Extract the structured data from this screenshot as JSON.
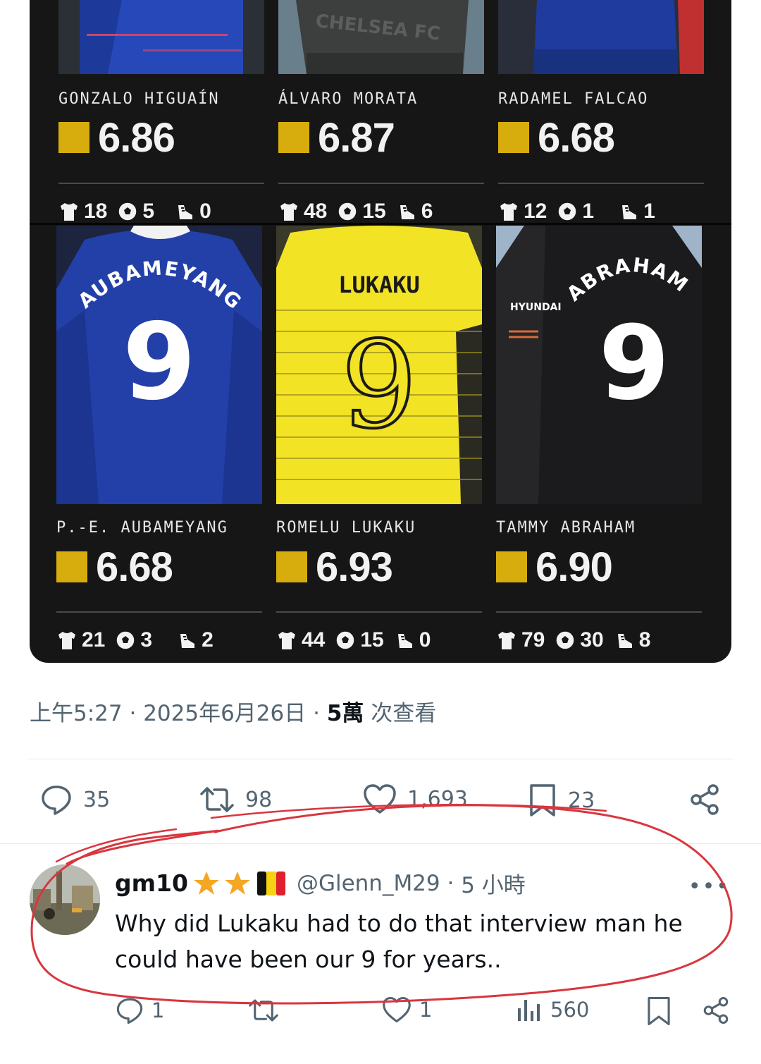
{
  "players_row1": [
    {
      "name": "GONZALO HIGUAÍN",
      "rating": "6.86",
      "apps": "18",
      "goals": "5",
      "assists": "0"
    },
    {
      "name": "ÁLVARO MORATA",
      "rating": "6.87",
      "apps": "48",
      "goals": "15",
      "assists": "6"
    },
    {
      "name": "RADAMEL FALCAO",
      "rating": "6.68",
      "apps": "12",
      "goals": "1",
      "assists": "1"
    }
  ],
  "players_row2": [
    {
      "name": "P.-E. AUBAMEYANG",
      "rating": "6.68",
      "apps": "21",
      "goals": "3",
      "assists": "2",
      "shirt_name": "AUBAMEYANG",
      "shirt_number": "9",
      "shirt_color": "#2340a8"
    },
    {
      "name": "ROMELU LUKAKU",
      "rating": "6.93",
      "apps": "44",
      "goals": "15",
      "assists": "0",
      "shirt_name": "LUKAKU",
      "shirt_number": "9",
      "shirt_color": "#f3e325"
    },
    {
      "name": "TAMMY ABRAHAM",
      "rating": "6.90",
      "apps": "79",
      "goals": "30",
      "assists": "8",
      "shirt_name": "ABRAHAM",
      "shirt_number": "9",
      "shirt_color": "#1b1b1d",
      "sponsor": "HYUNDAI"
    }
  ],
  "jersey_text_top": "CHELSEA FC",
  "tweet_meta": {
    "time": "上午5:27",
    "date": "2025年6月26日",
    "views": "5萬",
    "views_label": "次查看"
  },
  "tweet_actions": {
    "replies": "35",
    "retweets": "98",
    "likes": "1,693",
    "bookmarks": "23"
  },
  "reply": {
    "name": "gm10",
    "handle": "@Glenn_M29",
    "time": "5 小時",
    "text": "Why did Lukaku had to do that interview man he could have been our 9 for years..",
    "replies": "1",
    "retweets": "",
    "likes": "1",
    "views": "560"
  },
  "colors": {
    "rating_square": "#d6ad0d",
    "card_bg": "#161616",
    "annotation": "#d9363e",
    "secondary_text": "#536471"
  },
  "icons": [
    "shirt-icon",
    "ball-icon",
    "boot-icon",
    "reply-icon",
    "retweet-icon",
    "like-icon",
    "bookmark-icon",
    "share-icon",
    "views-icon",
    "more-icon",
    "star-icon",
    "belgium-flag-icon"
  ]
}
